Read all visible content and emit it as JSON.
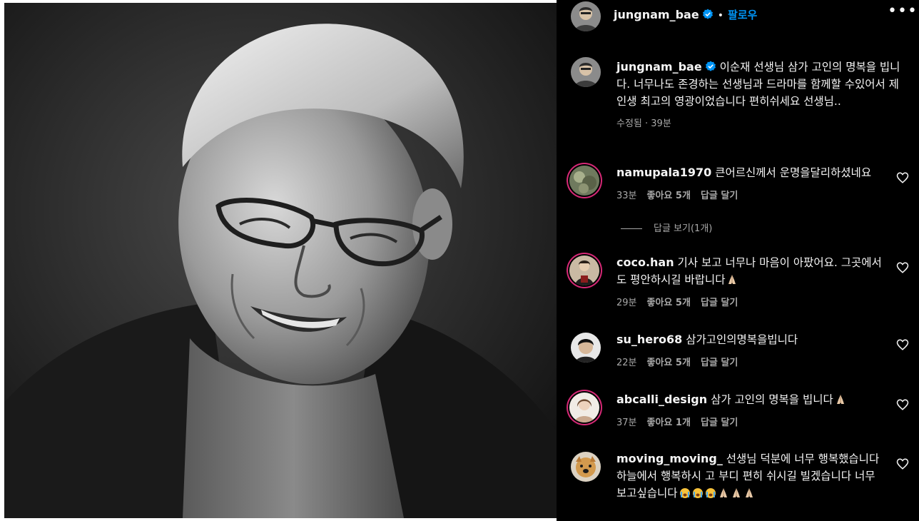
{
  "header": {
    "username": "jungnam_bae",
    "separator": "•",
    "follow_label": "팔로우",
    "more_label": "•••"
  },
  "caption": {
    "username": "jungnam_bae",
    "text": "이순재 선생님 삼가 고인의 명복을 빕니다. 너무나도 존경하는 선생님과 드라마를 함께할 수있어서 제인생 최고의 영광이었습니다 편히쉬세요 선생님..",
    "meta": "수정됨 · 39분"
  },
  "comments": [
    {
      "username": "namupala1970",
      "text": "큰어르신께서 운명을달리하셨네요",
      "time": "33분",
      "likes": "좋아요 5개",
      "reply": "답글 달기"
    },
    {
      "username": "coco.han",
      "text": "기사 보고 너무나 마음이 아팠어요. 그곳에서도 평안하시길 바랍니다",
      "time": "29분",
      "likes": "좋아요 5개",
      "reply": "답글 달기"
    },
    {
      "username": "su_hero68",
      "text": "삼가고인의명복을빕니다",
      "time": "22분",
      "likes": "좋아요 5개",
      "reply": "답글 달기"
    },
    {
      "username": "abcalli_design",
      "text": "삼가 고인의 명복을 빕니다",
      "time": "37분",
      "likes": "좋아요 1개",
      "reply": "답글 달기"
    },
    {
      "username": "moving_moving_",
      "text": "선생님 덕분에 너무 행복했습니다 하늘에서 행복하시 고 부디 편히 쉬시길 빌겠습니다 너무 보고싶습니다"
    }
  ],
  "view_replies": "답글 보기(1개)",
  "icons": {
    "verified": "verified-badge-icon",
    "more": "more-options-icon",
    "like": "heart-icon",
    "emoji_pray": "folded-hands-emoji",
    "emoji_cry": "crying-face-emoji"
  },
  "colors": {
    "background": "#000000",
    "text": "#f5f5f5",
    "secondary_text": "#a8a8a8",
    "link_blue": "#0095f6",
    "story_ring": "#d62976"
  }
}
